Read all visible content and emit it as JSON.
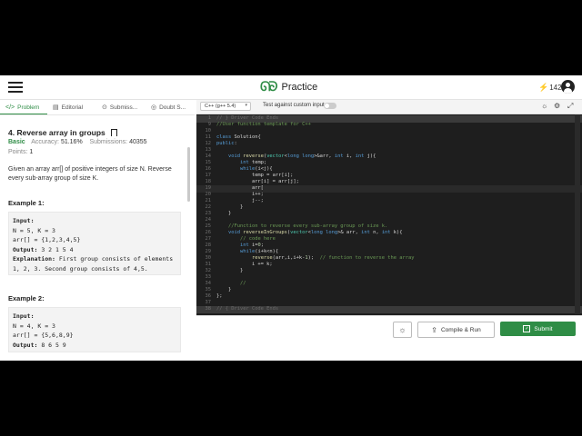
{
  "topbar": {
    "brand": "Practice",
    "streak_count": "142"
  },
  "tabs": [
    {
      "icon": "</>",
      "label": "Problem",
      "active": true
    },
    {
      "icon": "▤",
      "label": "Editorial",
      "active": false
    },
    {
      "icon": "⊙",
      "label": "Submiss...",
      "active": false
    },
    {
      "icon": "◎",
      "label": "Doubt S...",
      "active": false
    }
  ],
  "problem": {
    "title": "4. Reverse array in groups",
    "difficulty": "Basic",
    "accuracy_label": "Accuracy:",
    "accuracy": "51.16%",
    "submissions_label": "Submissions:",
    "submissions": "40355",
    "points_label": "Points:",
    "points": "1",
    "description": "Given an array arr[] of positive integers of size N. Reverse every sub-array group of size K."
  },
  "examples": [
    {
      "title": "Example 1:",
      "lines": [
        {
          "b": "Input:",
          "t": ""
        },
        {
          "b": "",
          "t": "N = 5, K = 3"
        },
        {
          "b": "",
          "t": "arr[] = {1,2,3,4,5}"
        },
        {
          "b": "Output:",
          "t": " 3 2 1 5 4"
        },
        {
          "b": "Explanation:",
          "t": " First group consists of elements"
        },
        {
          "b": "",
          "t": "1, 2, 3. Second group consists of 4,5."
        }
      ]
    },
    {
      "title": "Example 2:",
      "lines": [
        {
          "b": "Input:",
          "t": ""
        },
        {
          "b": "",
          "t": "N = 4, K = 3"
        },
        {
          "b": "",
          "t": "arr[] = {5,6,8,9}"
        },
        {
          "b": "Output:",
          "t": " 8 6 5 9"
        }
      ]
    }
  ],
  "editor": {
    "language": "C++ (g++ 5.4)",
    "custom_input_label": "Test against custom input",
    "compile_label": "Compile & Run",
    "submit_label": "Submit",
    "code_lines": [
      {
        "n": "1",
        "fold": true,
        "text": "// } Driver Code Ends"
      },
      {
        "n": "9",
        "text": "//User function template for C++"
      },
      {
        "n": "10",
        "text": ""
      },
      {
        "n": "11",
        "text": "class Solution{"
      },
      {
        "n": "12",
        "text": "public:"
      },
      {
        "n": "13",
        "text": ""
      },
      {
        "n": "14",
        "text": "    void reverse(vector<long long>&arr, int i, int j){"
      },
      {
        "n": "15",
        "text": "        int temp;"
      },
      {
        "n": "16",
        "text": "        while(i<j){"
      },
      {
        "n": "17",
        "text": "            temp = arr[i];"
      },
      {
        "n": "18",
        "text": "            arr[i] = arr[j];"
      },
      {
        "n": "19",
        "text": "            arr[",
        "cur": true
      },
      {
        "n": "20",
        "text": "            i++;"
      },
      {
        "n": "21",
        "text": "            j--;"
      },
      {
        "n": "22",
        "text": "        }"
      },
      {
        "n": "23",
        "text": "    }"
      },
      {
        "n": "24",
        "text": ""
      },
      {
        "n": "25",
        "text": "    //Function to reverse every sub-array group of size k."
      },
      {
        "n": "26",
        "text": "    void reverseInGroups(vector<long long>& arr, int n, int k){"
      },
      {
        "n": "27",
        "text": "        // code here"
      },
      {
        "n": "28",
        "text": "        int i=0;"
      },
      {
        "n": "29",
        "text": "        while(i+k<n){"
      },
      {
        "n": "30",
        "text": "            reverse(arr,i,i+k-1);  // function to reverse the array"
      },
      {
        "n": "31",
        "text": "            i += k;"
      },
      {
        "n": "32",
        "text": "        }"
      },
      {
        "n": "33",
        "text": ""
      },
      {
        "n": "34",
        "text": "        //"
      },
      {
        "n": "35",
        "text": "    }"
      },
      {
        "n": "36",
        "text": "};"
      },
      {
        "n": "37",
        "text": ""
      },
      {
        "n": "38",
        "fold": true,
        "text": "// { Driver Code Ends"
      }
    ]
  },
  "colors": {
    "brand_green": "#2f8d46",
    "editor_bg": "#1e1e1e"
  },
  "icons": [
    "hamburger-icon",
    "gfg-logo",
    "bolt-icon",
    "avatar",
    "bookmark-icon",
    "settings-icon",
    "fullscreen-icon",
    "theme-toggle-icon",
    "upload-icon"
  ]
}
